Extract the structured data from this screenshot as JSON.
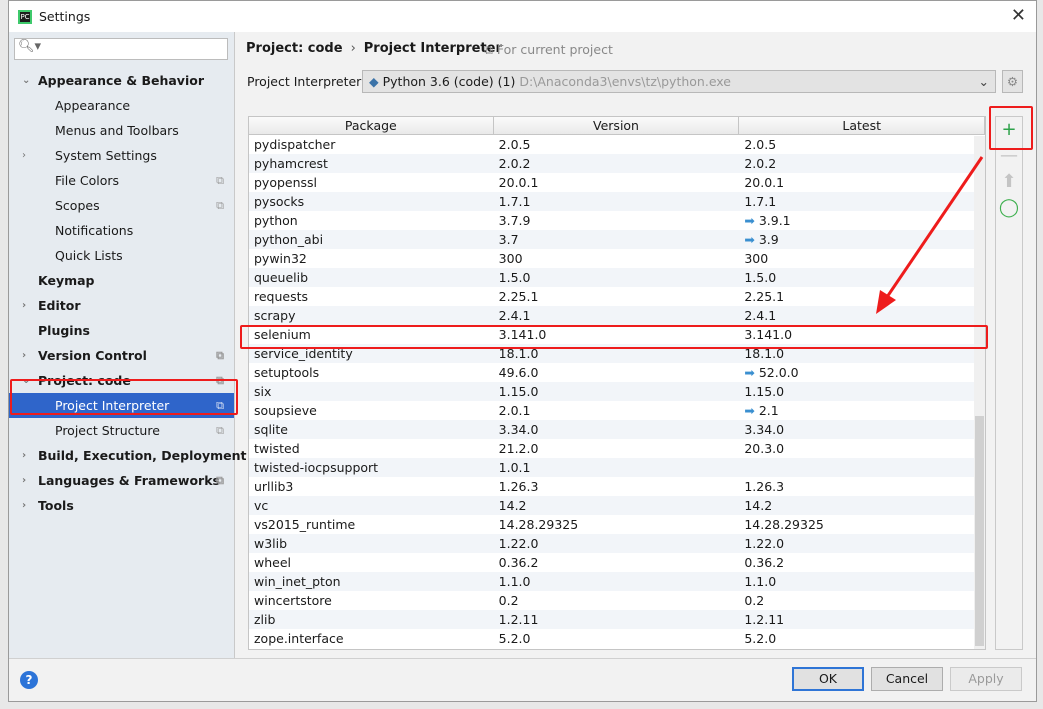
{
  "window": {
    "title": "Settings",
    "close": "✕"
  },
  "sidebar": {
    "search_placeholder": "",
    "items": [
      {
        "label": "Appearance & Behavior",
        "level": 0,
        "expand": "⌄"
      },
      {
        "label": "Appearance",
        "level": 1
      },
      {
        "label": "Menus and Toolbars",
        "level": 1
      },
      {
        "label": "System Settings",
        "level": 1,
        "expand": "›"
      },
      {
        "label": "File Colors",
        "level": 1,
        "copy": true
      },
      {
        "label": "Scopes",
        "level": 1,
        "copy": true
      },
      {
        "label": "Notifications",
        "level": 1
      },
      {
        "label": "Quick Lists",
        "level": 1
      },
      {
        "label": "Keymap",
        "level": 0
      },
      {
        "label": "Editor",
        "level": 0,
        "expand": "›"
      },
      {
        "label": "Plugins",
        "level": 0
      },
      {
        "label": "Version Control",
        "level": 0,
        "expand": "›",
        "copy": true
      },
      {
        "label": "Project: code",
        "level": 0,
        "expand": "⌄",
        "copy": true
      },
      {
        "label": "Project Interpreter",
        "level": 1,
        "copy": true,
        "selected": true
      },
      {
        "label": "Project Structure",
        "level": 1,
        "copy": true
      },
      {
        "label": "Build, Execution, Deployment",
        "level": 0,
        "expand": "›"
      },
      {
        "label": "Languages & Frameworks",
        "level": 0,
        "expand": "›",
        "copy": true
      },
      {
        "label": "Tools",
        "level": 0,
        "expand": "›"
      }
    ]
  },
  "breadcrumb": {
    "parent": "Project: code",
    "current": "Project Interpreter",
    "scope": "For current project"
  },
  "interpreter": {
    "label": "Project Interpreter:",
    "name": "Python 3.6 (code) (1)",
    "path": "D:\\Anaconda3\\envs\\tz\\python.exe"
  },
  "table": {
    "headers": [
      "Package",
      "Version",
      "Latest"
    ],
    "rows": [
      [
        "pydispatcher",
        "2.0.5",
        "2.0.5",
        false
      ],
      [
        "pyhamcrest",
        "2.0.2",
        "2.0.2",
        false
      ],
      [
        "pyopenssl",
        "20.0.1",
        "20.0.1",
        false
      ],
      [
        "pysocks",
        "1.7.1",
        "1.7.1",
        false
      ],
      [
        "python",
        "3.7.9",
        "3.9.1",
        true
      ],
      [
        "python_abi",
        "3.7",
        "3.9",
        true
      ],
      [
        "pywin32",
        "300",
        "300",
        false
      ],
      [
        "queuelib",
        "1.5.0",
        "1.5.0",
        false
      ],
      [
        "requests",
        "2.25.1",
        "2.25.1",
        false
      ],
      [
        "scrapy",
        "2.4.1",
        "2.4.1",
        false
      ],
      [
        "selenium",
        "3.141.0",
        "3.141.0",
        false
      ],
      [
        "service_identity",
        "18.1.0",
        "18.1.0",
        false
      ],
      [
        "setuptools",
        "49.6.0",
        "52.0.0",
        true
      ],
      [
        "six",
        "1.15.0",
        "1.15.0",
        false
      ],
      [
        "soupsieve",
        "2.0.1",
        "2.1",
        true
      ],
      [
        "sqlite",
        "3.34.0",
        "3.34.0",
        false
      ],
      [
        "twisted",
        "21.2.0",
        "20.3.0",
        false
      ],
      [
        "twisted-iocpsupport",
        "1.0.1",
        "",
        false
      ],
      [
        "urllib3",
        "1.26.3",
        "1.26.3",
        false
      ],
      [
        "vc",
        "14.2",
        "14.2",
        false
      ],
      [
        "vs2015_runtime",
        "14.28.29325",
        "14.28.29325",
        false
      ],
      [
        "w3lib",
        "1.22.0",
        "1.22.0",
        false
      ],
      [
        "wheel",
        "0.36.2",
        "0.36.2",
        false
      ],
      [
        "win_inet_pton",
        "1.1.0",
        "1.1.0",
        false
      ],
      [
        "wincertstore",
        "0.2",
        "0.2",
        false
      ],
      [
        "zlib",
        "1.2.11",
        "1.2.11",
        false
      ],
      [
        "zope.interface",
        "5.2.0",
        "5.2.0",
        false
      ]
    ]
  },
  "footer": {
    "help": "?",
    "ok": "OK",
    "cancel": "Cancel",
    "apply": "Apply"
  },
  "colors": {
    "accent": "#2f65ca",
    "annotation": "#ee1c1c",
    "add": "#2da24a",
    "upgrade": "#3a8fd0"
  }
}
